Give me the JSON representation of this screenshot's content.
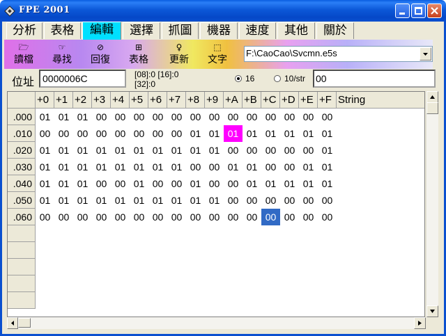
{
  "window": {
    "title": "FPE  2001",
    "colors": {
      "titlebar": "#0a5ee0",
      "active_tab": "#00e0ff",
      "highlight_magenta": "#ff00ff",
      "selection_blue": "#316ac5"
    }
  },
  "menu": {
    "tabs": [
      {
        "label": "分析",
        "active": false
      },
      {
        "label": "表格",
        "active": false
      },
      {
        "label": "編輯",
        "active": true
      },
      {
        "label": "選擇",
        "active": false
      },
      {
        "label": "抓圖",
        "active": false
      },
      {
        "label": "機器",
        "active": false
      },
      {
        "label": "速度",
        "active": false
      },
      {
        "label": "其他",
        "active": false
      },
      {
        "label": "關於",
        "active": false
      }
    ]
  },
  "toolbar": {
    "buttons": [
      {
        "label": "讀檔",
        "icon": "open-folder-icon",
        "glyph": "🗁"
      },
      {
        "label": "尋找",
        "icon": "find-icon",
        "glyph": "☞"
      },
      {
        "label": "回復",
        "icon": "undo-icon",
        "glyph": "⊘"
      },
      {
        "label": "表格",
        "icon": "table-icon",
        "glyph": "⊞"
      },
      {
        "label": "更新",
        "icon": "update-icon",
        "glyph": "♀"
      },
      {
        "label": "文字",
        "icon": "text-icon",
        "glyph": "⬚"
      }
    ],
    "path": "F:\\CaoCao\\Svcmn.e5s"
  },
  "address": {
    "label": "位址",
    "value": "0000006C",
    "ranges_line1": "[08]:0  [16]:0",
    "ranges_line2": "[32]:0",
    "radio_hex_label": "16",
    "radio_dec_label": "10/str",
    "radio_selected": "16",
    "value_field": "00"
  },
  "grid": {
    "col_headers": [
      "+0",
      "+1",
      "+2",
      "+3",
      "+4",
      "+5",
      "+6",
      "+7",
      "+8",
      "+9",
      "+A",
      "+B",
      "+C",
      "+D",
      "+E",
      "+F"
    ],
    "string_header": "String",
    "row_labels": [
      ".000",
      ".010",
      ".020",
      ".030",
      ".040",
      ".050",
      ".060",
      "",
      "",
      "",
      "",
      ""
    ],
    "rows": [
      [
        "01",
        "01",
        "01",
        "00",
        "00",
        "00",
        "00",
        "00",
        "00",
        "00",
        "00",
        "00",
        "00",
        "00",
        "00",
        "00"
      ],
      [
        "00",
        "00",
        "00",
        "00",
        "00",
        "00",
        "00",
        "00",
        "01",
        "01",
        "01",
        "01",
        "01",
        "01",
        "01",
        "01"
      ],
      [
        "01",
        "01",
        "01",
        "01",
        "01",
        "01",
        "01",
        "01",
        "01",
        "01",
        "00",
        "00",
        "00",
        "00",
        "00",
        "01"
      ],
      [
        "01",
        "01",
        "01",
        "01",
        "01",
        "01",
        "01",
        "01",
        "00",
        "00",
        "01",
        "01",
        "00",
        "00",
        "01",
        "01"
      ],
      [
        "01",
        "01",
        "01",
        "00",
        "00",
        "01",
        "00",
        "00",
        "01",
        "00",
        "00",
        "01",
        "01",
        "01",
        "01",
        "01"
      ],
      [
        "01",
        "01",
        "01",
        "01",
        "01",
        "01",
        "01",
        "01",
        "01",
        "01",
        "00",
        "00",
        "00",
        "00",
        "00",
        "00"
      ],
      [
        "00",
        "00",
        "00",
        "00",
        "00",
        "00",
        "00",
        "00",
        "00",
        "00",
        "00",
        "00",
        "00",
        "00",
        "00",
        "00"
      ]
    ],
    "highlight_magenta": {
      "row": 1,
      "col": 10
    },
    "selected_cell": {
      "row": 6,
      "col": 12
    }
  }
}
